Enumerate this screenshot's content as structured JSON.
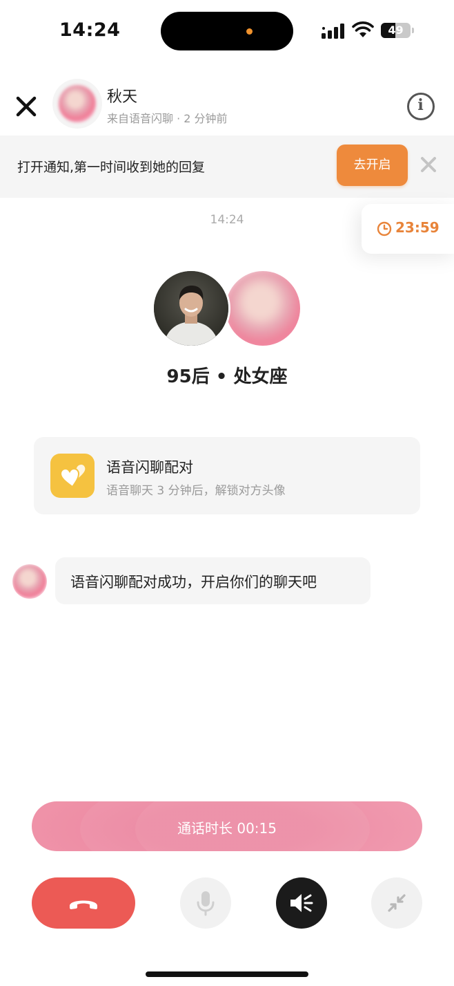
{
  "status_bar": {
    "time": "14:24",
    "battery_level": "49",
    "battery_fraction": 0.49
  },
  "header": {
    "contact_name": "秋天",
    "subtitle": "来自语音闪聊 · 2 分钟前"
  },
  "notification": {
    "text": "打开通知,第一时间收到她的回复",
    "button_label": "去开启"
  },
  "chat": {
    "timestamp": "14:24",
    "timer": "23:59",
    "match_caption": "95后 • 处女座",
    "card": {
      "title": "语音闪聊配对",
      "subtitle": "语音聊天 3 分钟后，解锁对方头像"
    },
    "message": "语音闪聊配对成功，开启你们的聊天吧"
  },
  "call": {
    "duration_label": "通话时长 00:15"
  },
  "icons": {
    "close": "close-icon",
    "info": "info-icon",
    "dismiss": "close-icon",
    "timer": "clock-icon",
    "card": "hearts-icon",
    "hangup": "phone-hangup-icon",
    "mic": "microphone-icon",
    "speaker": "speaker-icon",
    "minimize": "minimize-icon"
  },
  "colors": {
    "accent_orange": "#ee8a3c",
    "timer_orange": "#e8843a",
    "card_icon_yellow": "#f5c240",
    "call_bar_pink": "#ef92a8",
    "hangup_red": "#ec5a55",
    "speaker_active": "#1b1b1b"
  }
}
